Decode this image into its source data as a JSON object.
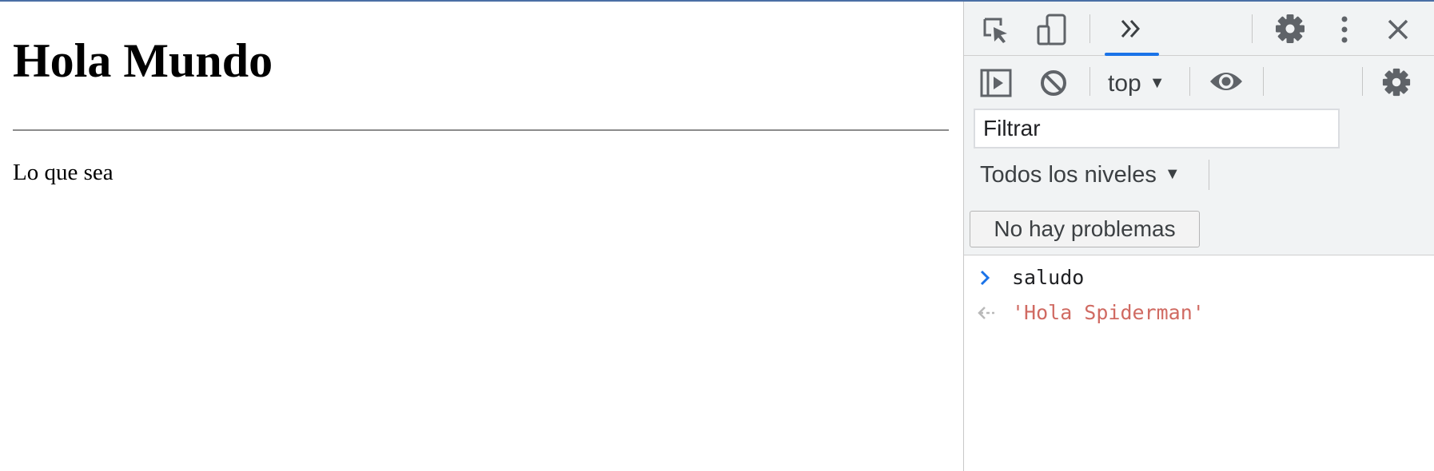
{
  "page": {
    "heading": "Hola Mundo",
    "paragraph": "Lo que sea"
  },
  "devtools": {
    "toolbar": {
      "icons": [
        "inspect-element-icon",
        "device-toggle-icon",
        "more-tabs-icon",
        "settings-icon",
        "more-options-icon",
        "close-icon"
      ],
      "active_tab": "more-tabs"
    },
    "console_toolbar": {
      "context_label": "top",
      "filter_placeholder": "Filtrar",
      "levels_label": "Todos los niveles",
      "issues_label": "No hay problemas"
    },
    "console": {
      "input": "saludo",
      "output": "'Hola Spiderman'"
    },
    "colors": {
      "accent": "#1a73e8",
      "string_output": "#d06a62"
    }
  }
}
